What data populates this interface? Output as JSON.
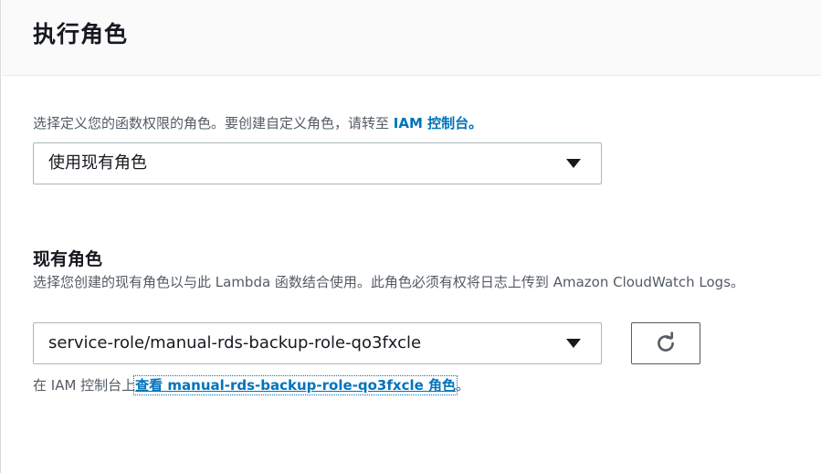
{
  "header": {
    "title": "执行角色"
  },
  "role_source": {
    "description_prefix": "选择定义您的函数权限的角色。要创建自定义角色，请转至 ",
    "console_link": "IAM 控制台。",
    "selected": "使用现有角色"
  },
  "existing_role": {
    "label": "现有角色",
    "description": "选择您创建的现有角色以与此 Lambda 函数结合使用。此角色必须有权将日志上传到 Amazon CloudWatch Logs。",
    "selected": "service-role/manual-rds-backup-role-qo3fxcle",
    "view_prefix": "在 IAM 控制台上",
    "view_link": "查看 manual-rds-backup-role-qo3fxcle 角色",
    "view_suffix": "。"
  },
  "icons": {
    "refresh": "refresh-icon",
    "caret": "caret-down-icon"
  },
  "colors": {
    "link": "#0073bb",
    "text": "#16191f",
    "secondary_text": "#545b64"
  }
}
